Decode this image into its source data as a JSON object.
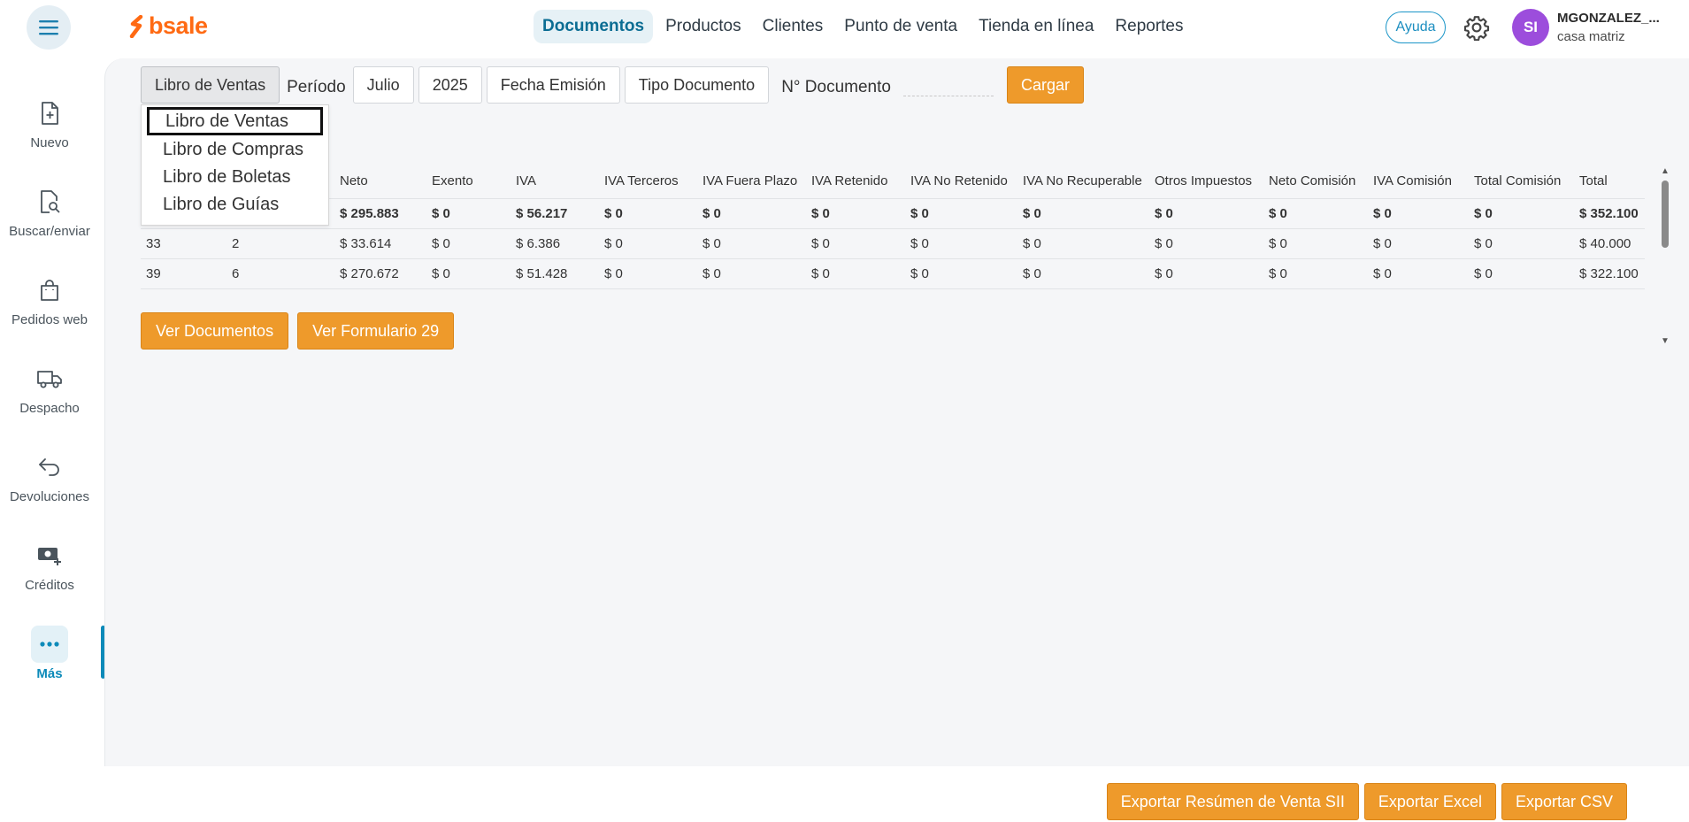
{
  "header": {
    "brand": "bsale",
    "nav": [
      {
        "label": "Documentos",
        "active": true
      },
      {
        "label": "Productos"
      },
      {
        "label": "Clientes"
      },
      {
        "label": "Punto de venta"
      },
      {
        "label": "Tienda en línea"
      },
      {
        "label": "Reportes"
      }
    ],
    "help_label": "Ayuda",
    "avatar_initials": "SI",
    "user_name": "MGONZALEZ_...",
    "user_branch": "casa matriz"
  },
  "sidebar": {
    "items": [
      {
        "label": "Nuevo",
        "icon": "file-plus-icon"
      },
      {
        "label": "Buscar/enviar",
        "icon": "file-search-icon"
      },
      {
        "label": "Pedidos web",
        "icon": "shopping-bag-icon"
      },
      {
        "label": "Despacho",
        "icon": "truck-icon"
      },
      {
        "label": "Devoluciones",
        "icon": "return-arrow-icon"
      },
      {
        "label": "Créditos",
        "icon": "money-plus-icon"
      },
      {
        "label": "Más",
        "icon": "more-dots-icon",
        "active": true
      }
    ]
  },
  "filters": {
    "book_selected": "Libro de Ventas",
    "period_label": "Período",
    "month": "Julio",
    "year": "2025",
    "date_type": "Fecha Emisión",
    "doc_type": "Tipo Documento",
    "doc_number_label": "N° Documento",
    "doc_number_value": "",
    "load_label": "Cargar"
  },
  "dropdown": {
    "options": [
      "Libro de Ventas",
      "Libro de Compras",
      "Libro de Boletas",
      "Libro de Guías"
    ],
    "focused_index": 0
  },
  "table": {
    "columns": [
      "",
      "",
      "Neto",
      "Exento",
      "IVA",
      "IVA Terceros",
      "IVA Fuera Plazo",
      "IVA Retenido",
      "IVA No Retenido",
      "IVA No Recuperable",
      "Otros Impuestos",
      "Neto Comisión",
      "IVA Comisión",
      "Total Comisión",
      "Total"
    ],
    "totals": [
      "",
      "",
      "$ 295.883",
      "$ 0",
      "$ 56.217",
      "$ 0",
      "$ 0",
      "$ 0",
      "$ 0",
      "$ 0",
      "$ 0",
      "$ 0",
      "$ 0",
      "$ 0",
      "$ 352.100"
    ],
    "rows": [
      [
        "33",
        "2",
        "$ 33.614",
        "$ 0",
        "$ 6.386",
        "$ 0",
        "$ 0",
        "$ 0",
        "$ 0",
        "$ 0",
        "$ 0",
        "$ 0",
        "$ 0",
        "$ 0",
        "$ 40.000"
      ],
      [
        "39",
        "6",
        "$ 270.672",
        "$ 0",
        "$ 51.428",
        "$ 0",
        "$ 0",
        "$ 0",
        "$ 0",
        "$ 0",
        "$ 0",
        "$ 0",
        "$ 0",
        "$ 0",
        "$ 322.100"
      ]
    ]
  },
  "actions": {
    "view_documents": "Ver Documentos",
    "view_form29": "Ver Formulario 29"
  },
  "footer": {
    "export_sii": "Exportar Resúmen de Venta SII",
    "export_excel": "Exportar Excel",
    "export_csv": "Exportar CSV"
  },
  "colors": {
    "brand_orange": "#ff6a13",
    "button_orange": "#ee9a2b",
    "accent_blue": "#0c8ab9",
    "avatar_purple": "#9c4ddc"
  }
}
